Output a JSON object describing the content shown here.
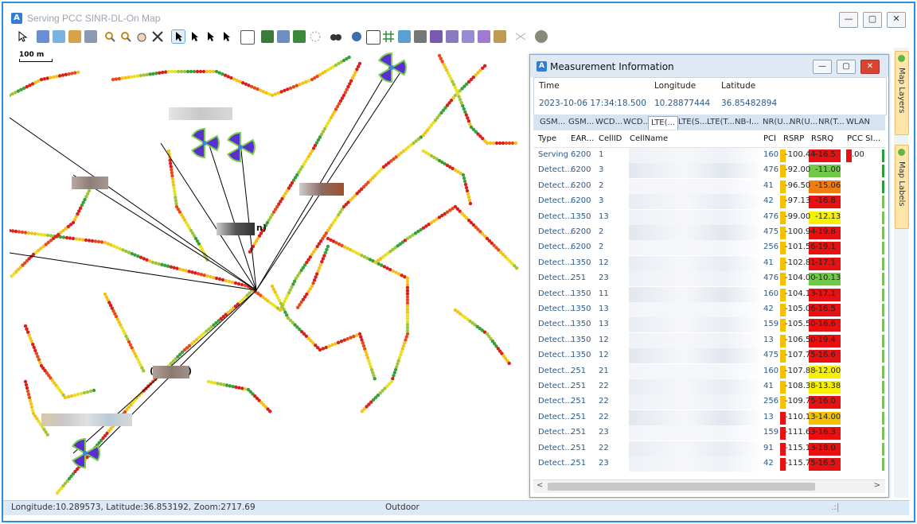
{
  "window": {
    "title": "Serving PCC SINR-DL-On Map",
    "app_icon": "A",
    "minimize": "—",
    "restore": "▢",
    "close": "✕"
  },
  "map": {
    "scale_label": "100 m",
    "labels": [
      "(",
      ")",
      "n)"
    ]
  },
  "sidebar": {
    "tabs": [
      "Map Layers",
      "Map Labels"
    ]
  },
  "status": {
    "coords": "Longitude:10.289573, Latitude:36.853192, Zoom:2717.69",
    "mode": "Outdoor",
    "grip": ".:|"
  },
  "panel": {
    "title": "Measurement Information",
    "icon": "A",
    "min": "—",
    "max": "▢",
    "close": "✕",
    "time_label": "Time",
    "lon_label": "Longitude",
    "lat_label": "Latitude",
    "time_value": "2023-10-06 17:34:18.500",
    "lon_value": "10.28877444",
    "lat_value": "36.85482894",
    "tabs": [
      "GSM...",
      "GSM...",
      "WCD...",
      "WCD...",
      "LTE(...",
      "LTE(S...",
      "LTE(T...",
      "NB-I...",
      "NR(U...",
      "NR(U...",
      "NR(T...",
      "WLAN"
    ],
    "columns": [
      "Type",
      "EAR...",
      "CellID",
      "CellName",
      "PCI",
      "RSRP",
      "RSRQ",
      "PCC SI..."
    ],
    "scroll_left": "<",
    "scroll_right": ">"
  },
  "rows": [
    {
      "type": "Serving",
      "ear": "6200",
      "cell": "1",
      "pci": "160",
      "rsrp": "-100.44",
      "rsrq": "-16.5",
      "sinr": ".00",
      "rsrp_color": "#f5c000",
      "rsrq_color": "#e81010"
    },
    {
      "type": "Detect...",
      "ear": "6200",
      "cell": "3",
      "pci": "476",
      "rsrp": "-92.00",
      "rsrq": "-11.00",
      "sinr": "",
      "rsrp_color": "#f5c000",
      "rsrq_color": "#72c84a"
    },
    {
      "type": "Detect...",
      "ear": "6200",
      "cell": "2",
      "pci": "41",
      "rsrp": "-96.50",
      "rsrq": "-15.06",
      "sinr": "",
      "rsrp_color": "#f5c000",
      "rsrq_color": "#f07d10"
    },
    {
      "type": "Detect...",
      "ear": "6200",
      "cell": "3",
      "pci": "42",
      "rsrp": "-97.13",
      "rsrq": "-16.8",
      "sinr": "",
      "rsrp_color": "#f5c000",
      "rsrq_color": "#e81010"
    },
    {
      "type": "Detect...",
      "ear": "1350",
      "cell": "13",
      "pci": "476",
      "rsrp": "-99.00",
      "rsrq": "-12.13",
      "sinr": "",
      "rsrp_color": "#f5c000",
      "rsrq_color": "#f7f000"
    },
    {
      "type": "Detect...",
      "ear": "6200",
      "cell": "2",
      "pci": "475",
      "rsrp": "-100.94",
      "rsrq": "-19.8",
      "sinr": "",
      "rsrp_color": "#f5c000",
      "rsrq_color": "#e81010"
    },
    {
      "type": "Detect...",
      "ear": "6200",
      "cell": "2",
      "pci": "256",
      "rsrp": "-101.56",
      "rsrq": "-19.1",
      "sinr": "",
      "rsrp_color": "#f5c000",
      "rsrq_color": "#e81010"
    },
    {
      "type": "Detect...",
      "ear": "1350",
      "cell": "12",
      "pci": "41",
      "rsrp": "-102.81",
      "rsrq": "-17.1",
      "sinr": "",
      "rsrp_color": "#f5c000",
      "rsrq_color": "#e81010"
    },
    {
      "type": "Detect...",
      "ear": "251",
      "cell": "23",
      "pci": "476",
      "rsrp": "-104.00",
      "rsrq": "-10.13",
      "sinr": "",
      "rsrp_color": "#f5c000",
      "rsrq_color": "#72c84a"
    },
    {
      "type": "Detect...",
      "ear": "1350",
      "cell": "11",
      "pci": "160",
      "rsrp": "-104.13",
      "rsrq": "-17.1",
      "sinr": "",
      "rsrp_color": "#f5c000",
      "rsrq_color": "#e81010"
    },
    {
      "type": "Detect...",
      "ear": "1350",
      "cell": "13",
      "pci": "42",
      "rsrp": "-105.06",
      "rsrq": "-16.5",
      "sinr": "",
      "rsrp_color": "#f5c000",
      "rsrq_color": "#e81010"
    },
    {
      "type": "Detect...",
      "ear": "1350",
      "cell": "13",
      "pci": "159",
      "rsrp": "-105.50",
      "rsrq": "-16.6",
      "sinr": "",
      "rsrp_color": "#f5c000",
      "rsrq_color": "#e81010"
    },
    {
      "type": "Detect...",
      "ear": "1350",
      "cell": "12",
      "pci": "13",
      "rsrp": "-106.50",
      "rsrq": "-19.4",
      "sinr": "",
      "rsrp_color": "#f5c000",
      "rsrq_color": "#e81010"
    },
    {
      "type": "Detect...",
      "ear": "1350",
      "cell": "12",
      "pci": "475",
      "rsrp": "-107.75",
      "rsrq": "-16.6",
      "sinr": "",
      "rsrp_color": "#f5c000",
      "rsrq_color": "#e81010"
    },
    {
      "type": "Detect...",
      "ear": "251",
      "cell": "21",
      "pci": "160",
      "rsrp": "-107.88",
      "rsrq": "-12.00",
      "sinr": "",
      "rsrp_color": "#f5c000",
      "rsrq_color": "#f7f000"
    },
    {
      "type": "Detect...",
      "ear": "251",
      "cell": "22",
      "pci": "41",
      "rsrp": "-108.38",
      "rsrq": "-13.38",
      "sinr": "",
      "rsrp_color": "#f5c000",
      "rsrq_color": "#f7f000"
    },
    {
      "type": "Detect...",
      "ear": "251",
      "cell": "22",
      "pci": "256",
      "rsrp": "-109.75",
      "rsrq": "-16.0",
      "sinr": "",
      "rsrp_color": "#f5c000",
      "rsrq_color": "#e81010"
    },
    {
      "type": "Detect...",
      "ear": "251",
      "cell": "22",
      "pci": "13",
      "rsrp": "-110.13",
      "rsrq": "-14.00",
      "sinr": "",
      "rsrp_color": "#e81010",
      "rsrq_color": "#f5c000"
    },
    {
      "type": "Detect...",
      "ear": "251",
      "cell": "23",
      "pci": "159",
      "rsrp": "-111.63",
      "rsrq": "-16.3",
      "sinr": "",
      "rsrp_color": "#e81010",
      "rsrq_color": "#e81010"
    },
    {
      "type": "Detect...",
      "ear": "251",
      "cell": "22",
      "pci": "91",
      "rsrp": "-115.13",
      "rsrq": "-18.0",
      "sinr": "",
      "rsrp_color": "#e81010",
      "rsrq_color": "#e81010"
    },
    {
      "type": "Detect...",
      "ear": "251",
      "cell": "23",
      "pci": "42",
      "rsrp": "-115.75",
      "rsrq": "-16.5",
      "sinr": "",
      "rsrp_color": "#e81010",
      "rsrq_color": "#e81010"
    }
  ]
}
